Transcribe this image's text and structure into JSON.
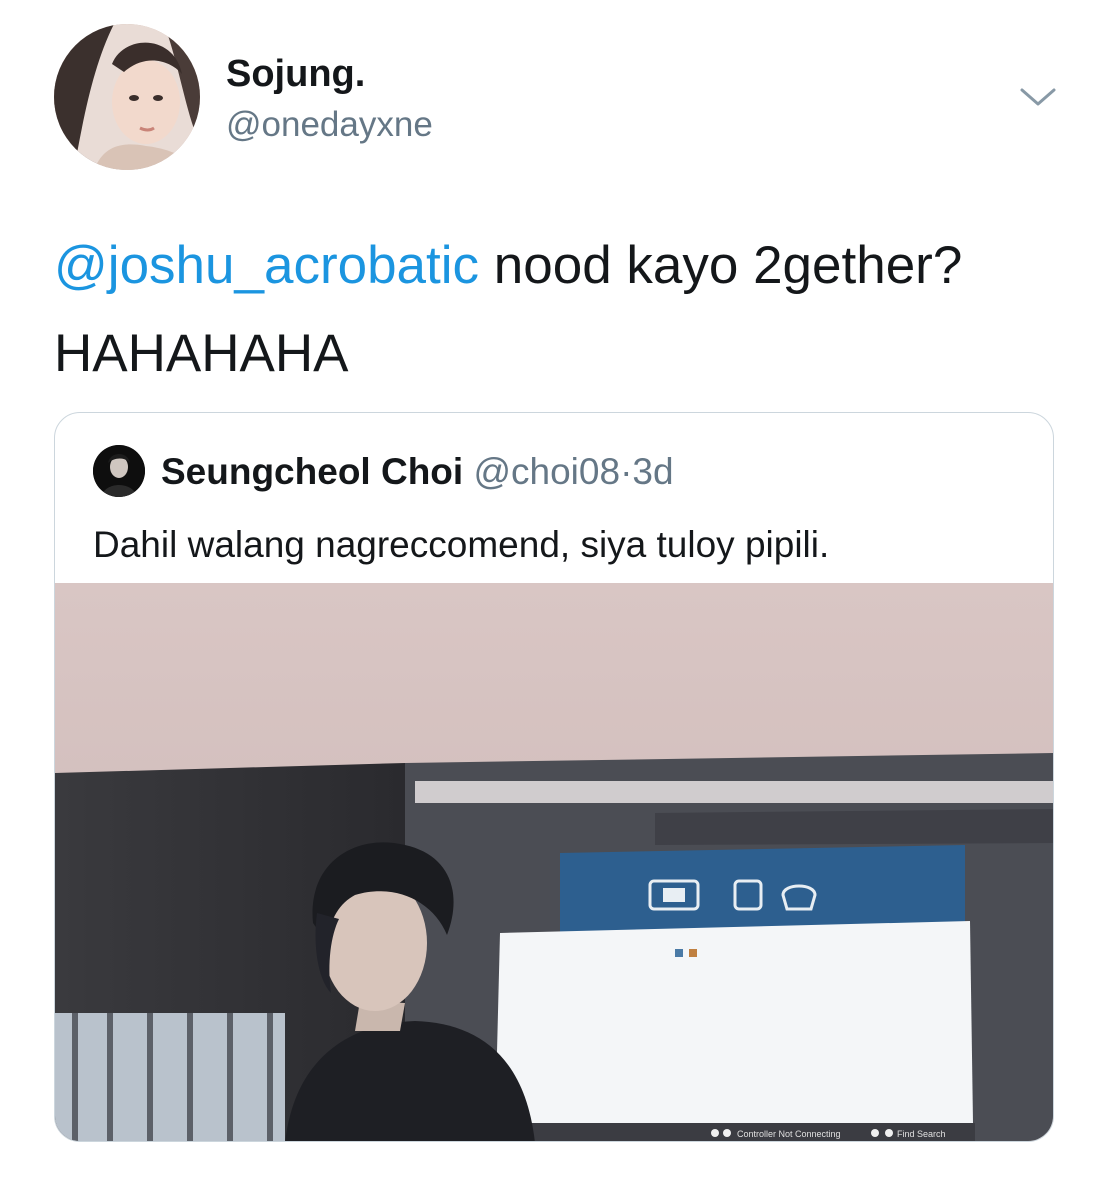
{
  "tweet": {
    "display_name": "Sojung.",
    "handle": "@onedayxne",
    "mention": "@joshu_acrobatic",
    "text": " nood kayo 2gether? HAHAHAHA"
  },
  "quoted_tweet": {
    "display_name": "Seungcheol Choi",
    "handle": "@choi08",
    "separator": "·",
    "time": "3d",
    "text": "Dahil walang nagreccomend, siya tuloy pipili.",
    "screen_status": "Controller Not Connecting",
    "screen_search": "Find Search"
  },
  "icons": {
    "caret": "chevron-down-icon"
  },
  "colors": {
    "link": "#1b95e0",
    "secondary_text": "#657786",
    "border": "#ccd6dd"
  }
}
